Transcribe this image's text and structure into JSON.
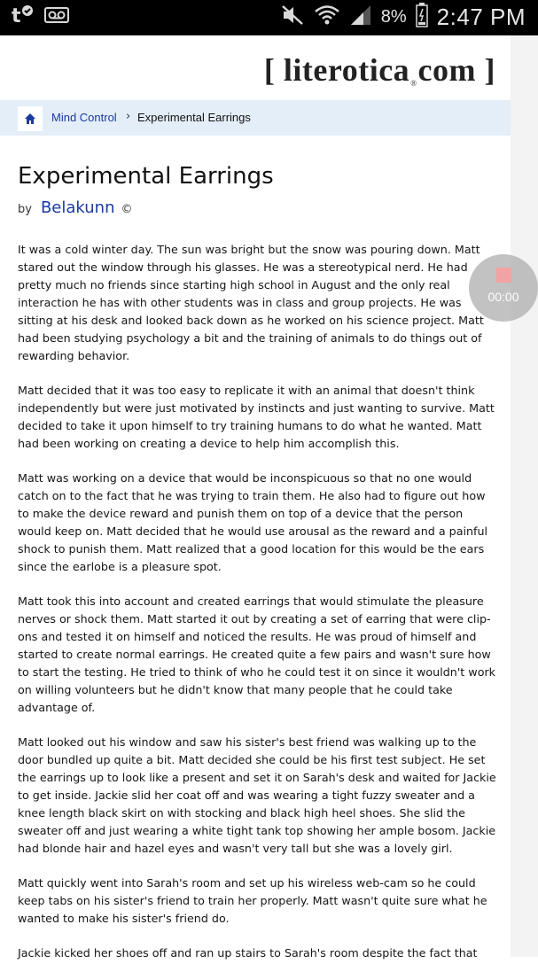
{
  "status_bar": {
    "time": "2:47 PM",
    "battery": "8%"
  },
  "site": {
    "logo_text": "[ literotica",
    "logo_reg": "®",
    "logo_tail": "com ]"
  },
  "breadcrumb": {
    "category": "Mind Control",
    "separator": "›",
    "current": "Experimental Earrings"
  },
  "story": {
    "title": "Experimental Earrings",
    "by_label": "by",
    "author": "Belakunn",
    "copyright": "©",
    "paragraphs": [
      "It was a cold winter day. The sun was bright but the snow was pouring down. Matt stared out the window through his glasses. He was a stereotypical nerd. He had pretty much no friends since starting high school in August and the only real interaction he has with other students was in class and group projects. He was sitting at his desk and looked back down as he worked on his science project. Matt had been studying psychology a bit and the training of animals to do things out of rewarding behavior.",
      "Matt decided that it was too easy to replicate it with an animal that doesn't think independently but were just motivated by instincts and just wanting to survive. Matt decided to take it upon himself to try training humans to do what he wanted. Matt had been working on creating a device to help him accomplish this.",
      "Matt was working on a device that would be inconspicuous so that no one would catch on to the fact that he was trying to train them. He also had to figure out how to make the device reward and punish them on top of a device that the person would keep on. Matt decided that he would use arousal as the reward and a painful shock to punish them. Matt realized that a good location for this would be the ears since the earlobe is a pleasure spot.",
      "Matt took this into account and created earrings that would stimulate the pleasure nerves or shock them. Matt started it out by creating a set of earring that were clip-ons and tested it on himself and noticed the results. He was proud of himself and started to create normal earrings. He created quite a few pairs and wasn't sure how to start the testing. He tried to think of who he could test it on since it wouldn't work on willing volunteers but he didn't know that many people that he could take advantage of.",
      "Matt looked out his window and saw his sister's best friend was walking up to the door bundled up quite a bit. Matt decided she could be his first test subject. He set the earrings up to look like a present and set it on Sarah's desk and waited for Jackie to get inside. Jackie slid her coat off and was wearing a tight fuzzy sweater and a knee length black skirt on with stocking and black high heel shoes. She slid the sweater off and just wearing a white tight tank top showing her ample bosom. Jackie had blonde hair and hazel eyes and wasn't very tall but she was a lovely girl.",
      "Matt quickly went into Sarah's room and set up his wireless web-cam so he could keep tabs on his sister's friend to train her properly. Matt wasn't quite sure what he wanted to make his sister's friend do.",
      "Jackie kicked her shoes off and ran up stairs to Sarah's room despite the fact that"
    ]
  },
  "recorder": {
    "time": "00:00"
  },
  "colors": {
    "link": "#1a3aa0",
    "breadcrumb_bg": "#e4eef8",
    "statusbar_bg": "#000000"
  }
}
